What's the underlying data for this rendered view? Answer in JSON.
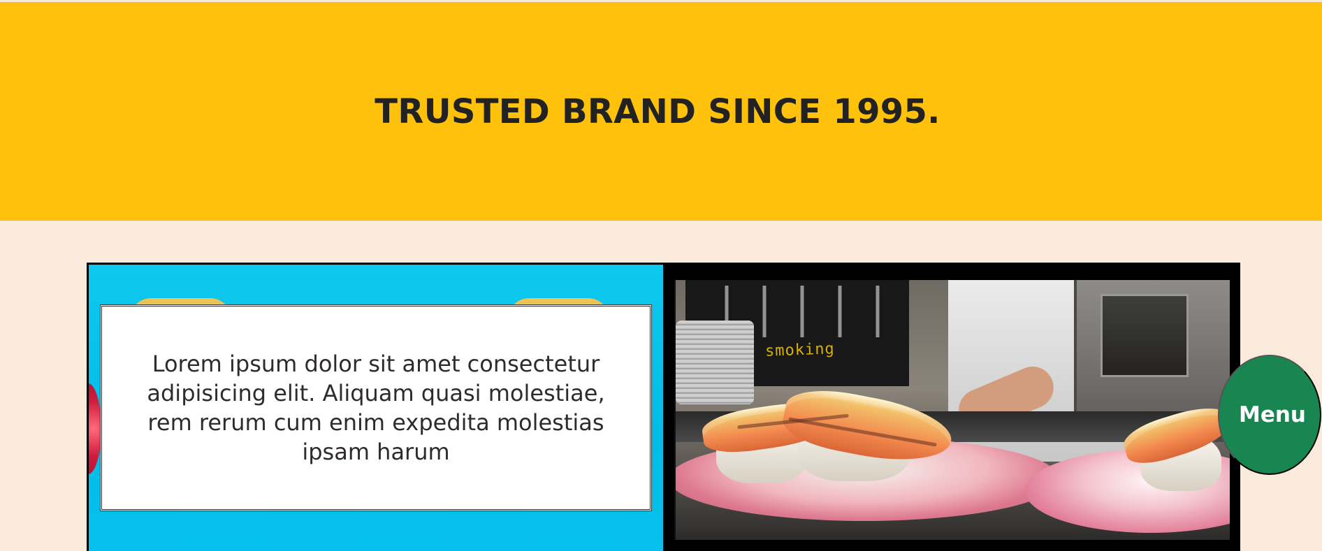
{
  "hero": {
    "title": "TRUSTED BRAND SINCE 1995."
  },
  "feature": {
    "card_text": "Lorem ipsum dolor sit amet consectetur adipisicing elit. Aliquam quasi molestiae, rem rerum cum enim expedita molestias ipsam harum"
  },
  "photo": {
    "sign_text": "smoking"
  },
  "floating": {
    "menu_label": "Menu"
  },
  "colors": {
    "hero_background": "#fec20c",
    "page_background": "#f9eadb",
    "menu_button": "#198652"
  }
}
